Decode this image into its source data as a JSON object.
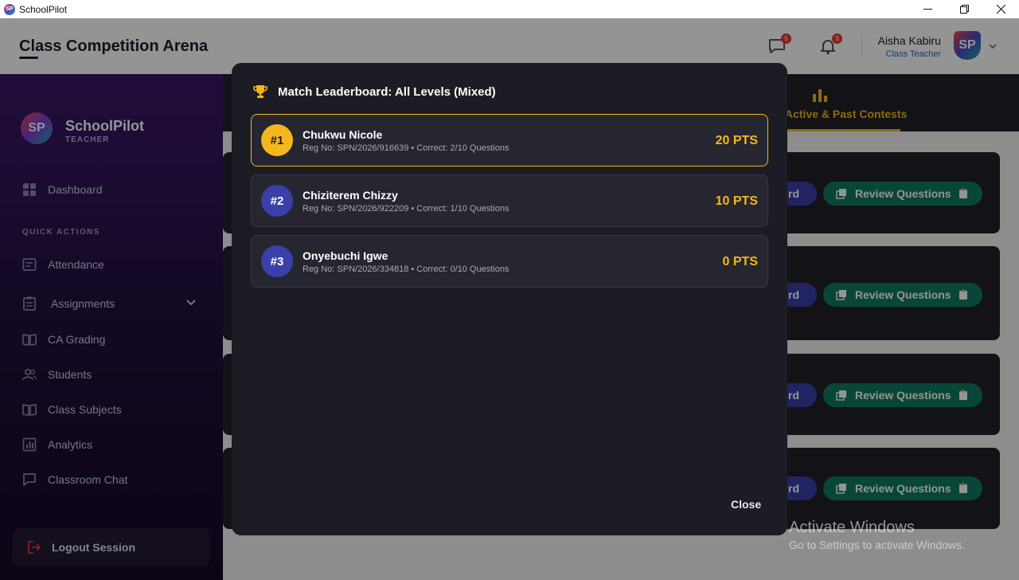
{
  "window": {
    "title": "SchoolPilot",
    "icon": "app-logo-icon",
    "controls": [
      "minimize-icon",
      "restore-icon",
      "close-icon"
    ]
  },
  "header": {
    "page_title": "Class Competition Arena",
    "messages_badge": "5",
    "notifications_badge": "3",
    "user_name": "Aisha Kabiru",
    "user_role": "Class Teacher",
    "avatar_text": "SP"
  },
  "sidebar": {
    "brand_name": "SchoolPilot",
    "brand_sub": "TEACHER",
    "logo_text": "SP",
    "dashboard": "Dashboard",
    "section_label": "QUICK ACTIONS",
    "items": [
      {
        "label": "Attendance",
        "icon": "attendance-icon"
      },
      {
        "label": "Assignments",
        "icon": "assignments-icon"
      },
      {
        "label": "CA Grading",
        "icon": "book-icon"
      },
      {
        "label": "Students",
        "icon": "students-icon"
      },
      {
        "label": "Class Subjects",
        "icon": "book-icon"
      },
      {
        "label": "Analytics",
        "icon": "analytics-icon"
      },
      {
        "label": "Classroom Chat",
        "icon": "chat-icon"
      }
    ],
    "logout": "Logout Session"
  },
  "main": {
    "active_tab": "Active & Past Contests",
    "card_blue_label": "rd",
    "review_label": "Review Questions"
  },
  "modal": {
    "title": "Match Leaderboard: All Levels (Mixed)",
    "entries": [
      {
        "rank": "#1",
        "name": "Chukwu Nicole",
        "meta": "Reg No: SPN/2026/916639 • Correct: 2/10 Questions",
        "points": "20 PTS"
      },
      {
        "rank": "#2",
        "name": "Chiziterem Chizzy",
        "meta": "Reg No: SPN/2026/922209 • Correct: 1/10 Questions",
        "points": "10 PTS"
      },
      {
        "rank": "#3",
        "name": "Onyebuchi Igwe",
        "meta": "Reg No: SPN/2026/334818 • Correct: 0/10 Questions",
        "points": "0 PTS"
      }
    ],
    "close_label": "Close"
  },
  "watermark": {
    "title": "Activate Windows",
    "subtitle": "Go to Settings to activate Windows."
  },
  "colors": {
    "accent_gold": "#f5b71c",
    "accent_blue": "#3b3fa8",
    "accent_green": "#0f7a5f",
    "modal_bg": "#1c1c24"
  }
}
